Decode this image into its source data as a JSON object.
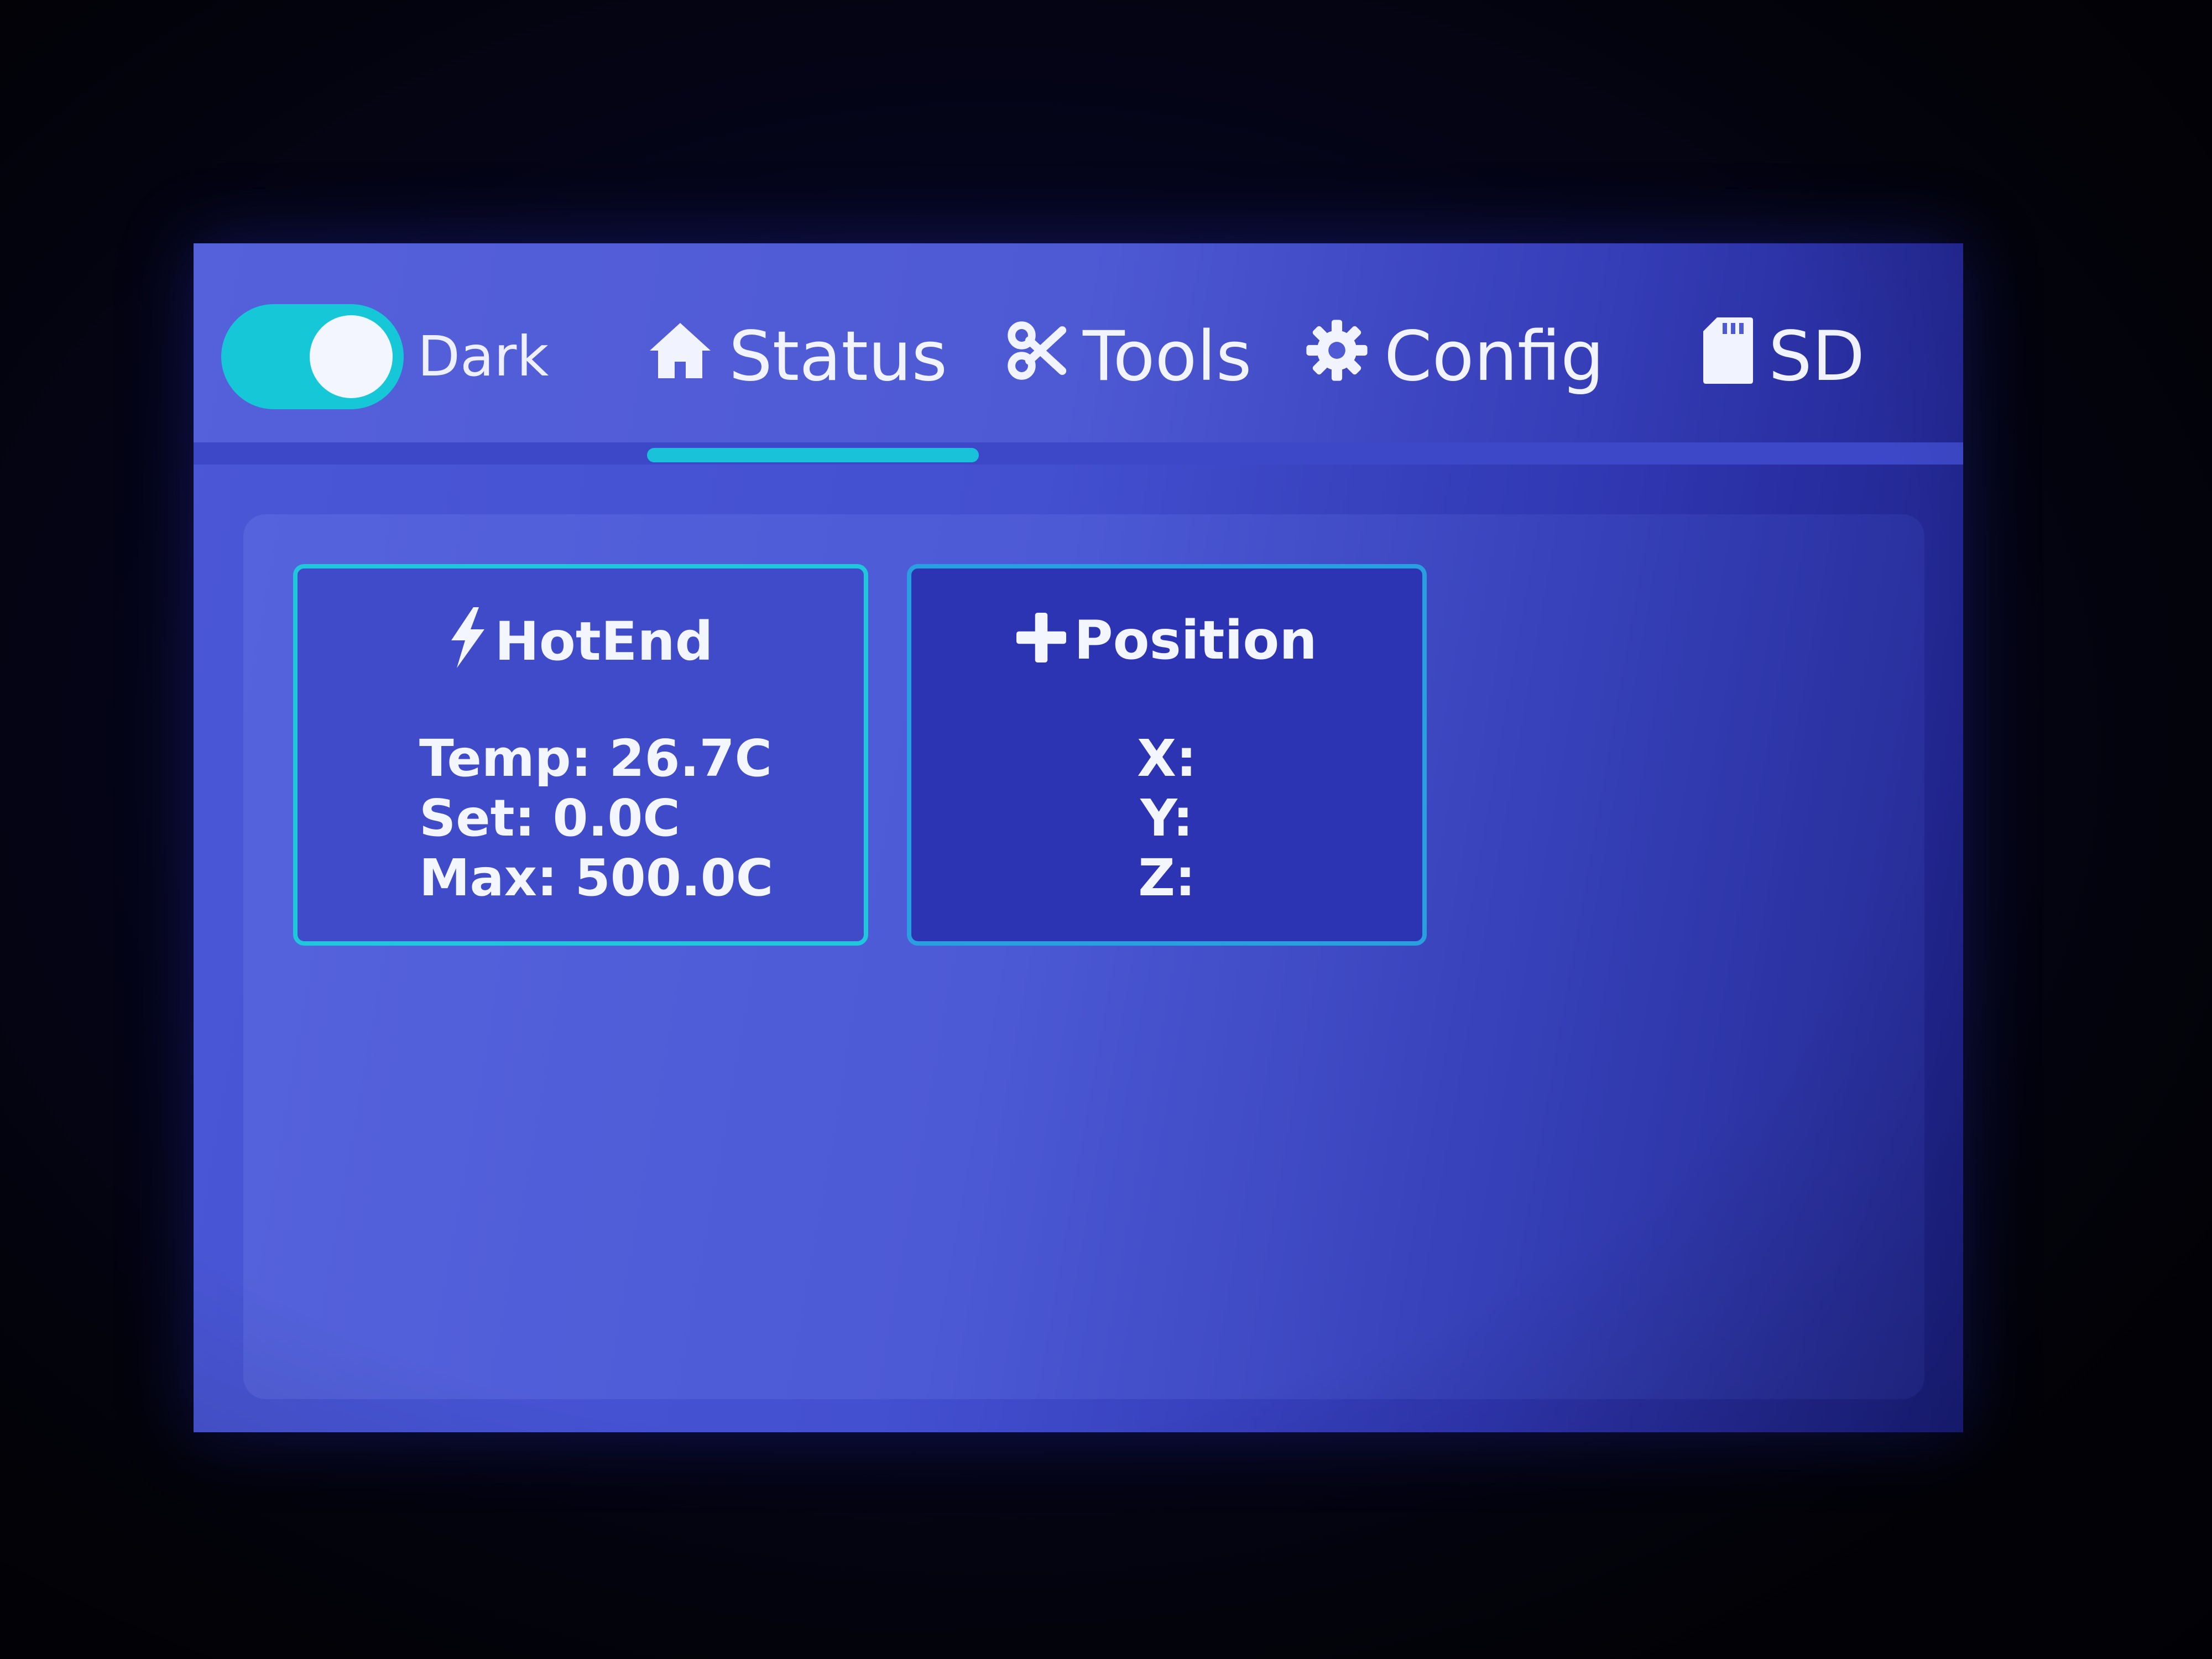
{
  "theme_toggle": {
    "label": "Dark",
    "state": "on"
  },
  "tabs": [
    {
      "label": "Status",
      "icon": "home-icon",
      "active": true
    },
    {
      "label": "Tools",
      "icon": "tools-icon",
      "active": false
    },
    {
      "label": "Config",
      "icon": "gear-icon",
      "active": false
    },
    {
      "label": "SD",
      "icon": "sd-card-icon",
      "active": false
    }
  ],
  "hotend": {
    "title": "HotEnd",
    "icon": "bolt-icon",
    "temp": "Temp: 26.7C",
    "set": "Set: 0.0C",
    "max": "Max: 500.0C"
  },
  "position": {
    "title": "Position",
    "icon": "plus-icon",
    "x": "X:",
    "y": "Y:",
    "z": "Z:"
  },
  "colors": {
    "accent": "#19c2d8",
    "screen_bg": "#4a57d6",
    "text": "#f1f3ff"
  }
}
